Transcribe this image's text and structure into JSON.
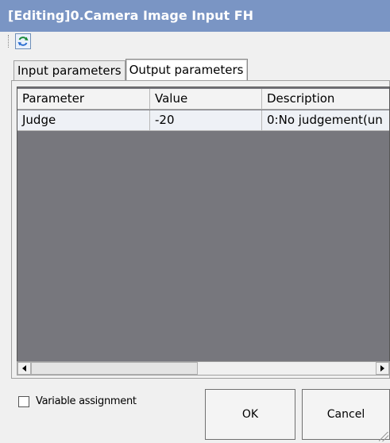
{
  "window": {
    "title": "[Editing]0.Camera Image Input FH"
  },
  "toolbar": {
    "refresh_icon": "refresh-icon"
  },
  "tabs": [
    {
      "label": "Input parameters",
      "active": false
    },
    {
      "label": "Output parameters",
      "active": true
    }
  ],
  "grid": {
    "columns": [
      "Parameter",
      "Value",
      "Description"
    ],
    "rows": [
      {
        "parameter": "Judge",
        "value": "-20",
        "description": "0:No judgement(un"
      }
    ]
  },
  "footer": {
    "variable_assignment_label": "Variable assignment",
    "variable_assignment_checked": false,
    "ok_label": "OK",
    "cancel_label": "Cancel"
  },
  "colors": {
    "title_bar": "#7a95c4",
    "grid_background": "#77777d"
  }
}
